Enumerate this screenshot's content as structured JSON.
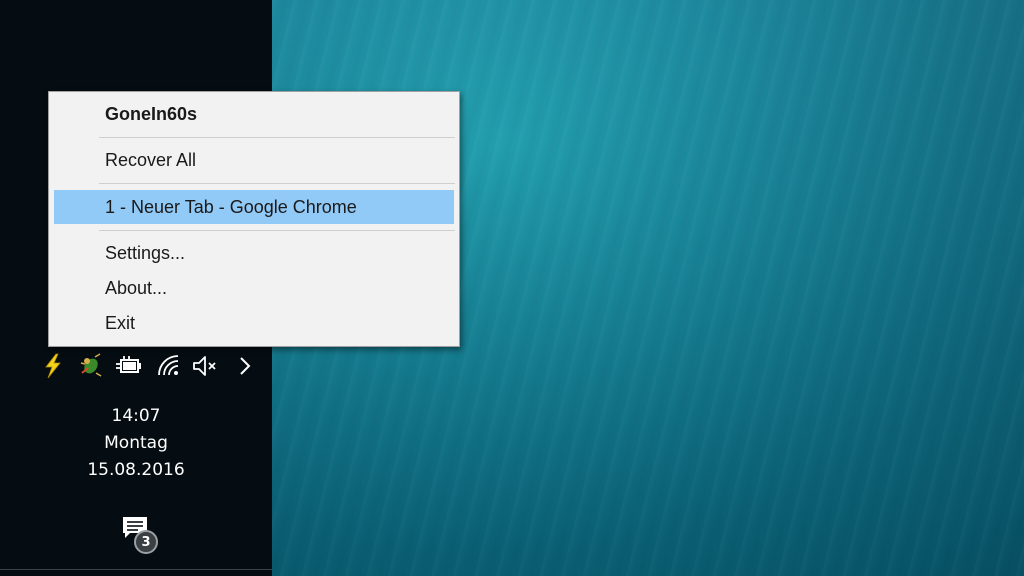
{
  "context_menu": {
    "title": "GoneIn60s",
    "recover_all": "Recover All",
    "window_entry": "1 - Neuer Tab - Google Chrome",
    "settings": "Settings...",
    "about": "About...",
    "exit": "Exit",
    "highlight_color": "#91c9f7"
  },
  "tray": {
    "icons": [
      "lightning-icon",
      "bug-tool-icon",
      "battery-plug-icon",
      "wifi-icon",
      "speaker-muted-icon",
      "chevron-right-icon"
    ]
  },
  "clock": {
    "time": "14:07",
    "day": "Montag",
    "date": "15.08.2016"
  },
  "action_center": {
    "badge_count": "3"
  },
  "colors": {
    "taskbar": "#050d12",
    "desktop": "#12849a",
    "menu_bg": "#f2f2f2"
  }
}
